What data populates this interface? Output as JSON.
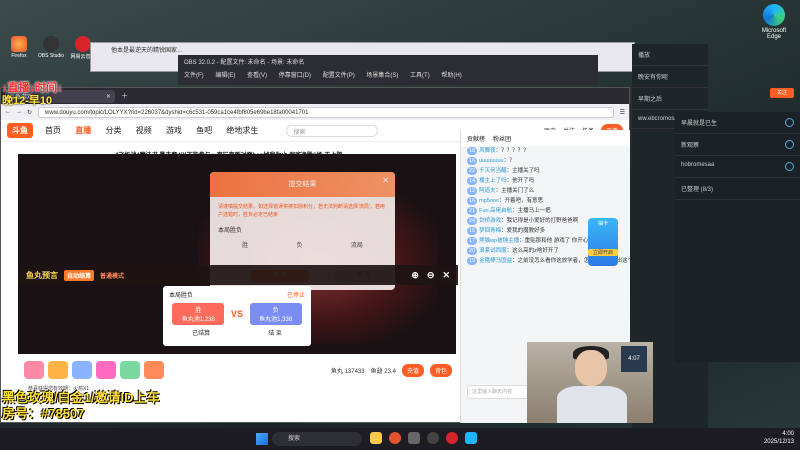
{
  "desktop": {
    "edge_label": "Microsoft Edge",
    "icons": [
      "Firefox",
      "OBS Studio",
      "网易云音乐"
    ]
  },
  "overlay": {
    "line1": "↓直播↓时间↓",
    "line2": "晚12-早10",
    "bottom1": "黑色玫瑰/白金1/邀请ID上车",
    "bottom2": "房号：#78507"
  },
  "obs": {
    "title": "OBS 32.0.2 - 配置文件: 未命名 - 场景: 未命名",
    "menu": [
      "文件(F)",
      "编辑(E)",
      "查看(V)",
      "停靠窗口(D)",
      "配置文件(P)",
      "场景集合(S)",
      "工具(T)",
      "帮助(H)"
    ]
  },
  "browser": {
    "tab_title": "斗鱼游戏",
    "url": "www.douyu.com/topic/LOLYYX?rid=226037&dyshid=c6c531-059ca1ce4fbf805e69be18fa00041701",
    "back_tab": "他本是最逆天的精锐国家…"
  },
  "douyu": {
    "logo": "斗鱼",
    "nav": [
      "首页",
      "直播",
      "分类",
      "视频",
      "游戏",
      "鱼吧",
      "绝地求生"
    ],
    "search_placeholder": "搜索",
    "header_icons": [
      "历史",
      "关注",
      "任务",
      "开播"
    ],
    "subheadline": "4飞机战4魔法书   暴击套4以下能参与一直玩直到对面ban掉我为止   保底净胜6场-无上限"
  },
  "modal": {
    "title": "提交结果",
    "text": "请谨慎提交结果，如选择错误将被扣除积分；若无法判断请选择'流局'，若用户选错时，胜负必定已结束",
    "label": "本局胜负",
    "options": [
      "胜",
      "负",
      "流局"
    ],
    "cancel": "取 消",
    "confirm": "确 定"
  },
  "yuwan": {
    "title": "鱼丸预言",
    "tag": "自动结算",
    "mode": "普通模式"
  },
  "vote": {
    "title": "本局胜负",
    "status": "已停止",
    "left": "胜",
    "left_sub": "鱼丸池1,238",
    "right": "负",
    "right_sub": "鱼丸池1,338",
    "vs": "VS",
    "foot_left": "已结算",
    "foot_right": "结 束"
  },
  "giftbar": {
    "fish_count": "鱼丸 137433",
    "fins": "鱼翅 23.4",
    "charge": "充值",
    "backpack": "背包"
  },
  "notice": "恭喜获得您有效期：火箭X1",
  "chat": {
    "tabs": [
      "贡献榜",
      "粉丝团"
    ],
    "lines": [
      {
        "lvl": "18",
        "user": "风舞夜",
        "text": "？？？？？"
      },
      {
        "lvl": "16",
        "user": "uuuuuuuu",
        "text": "？"
      },
      {
        "lvl": "22",
        "user": "千灭何当醒",
        "text": "主播关了吗"
      },
      {
        "lvl": "14",
        "user": "楼主上了吗",
        "text": "他开了吗"
      },
      {
        "lvl": "12",
        "user": "阿道夫",
        "text": "主播关门了么"
      },
      {
        "lvl": "16",
        "user": "mp5ooo",
        "text": "开着吧，有意思"
      },
      {
        "lvl": "21",
        "user": "Fun.高佬启航",
        "text": "主播马上一把"
      },
      {
        "lvl": "24",
        "user": "剑桥游戏",
        "text": "我记得是小爱好的打野爸爸啊"
      },
      {
        "lvl": "15",
        "user": "梦回青梅",
        "text": "爱我的魔教好多"
      },
      {
        "lvl": "17",
        "user": "熊猫wp被锤主播",
        "text": "重贴那和他 游戏了 你开心了不 望望"
      },
      {
        "lvl": "20",
        "user": "滚紧试西服",
        "text": "这么高的z啥好开了"
      },
      {
        "lvl": "19",
        "user": "金箍棒马国益",
        "text": "之前没怎么看你这放学者，怎么突然开始出这个"
      }
    ],
    "input_placeholder": "这里输入聊天内容",
    "send": "发送",
    "pet_label": "抽卡",
    "pet_sub": "立即开启"
  },
  "rightpanel": {
    "items": [
      "播放",
      "晚安有你呢",
      "早期之后",
      "ww.ebcromosa"
    ],
    "follow_button": "关注",
    "game_rows": [
      "早晨就是已生",
      "新观察",
      "hobromesaa",
      "已整理 (8/3)"
    ]
  },
  "cam": {
    "clock": "4:07"
  },
  "taskbar": {
    "search": "搜索",
    "time": "4:00",
    "date": "2025/12/13"
  }
}
